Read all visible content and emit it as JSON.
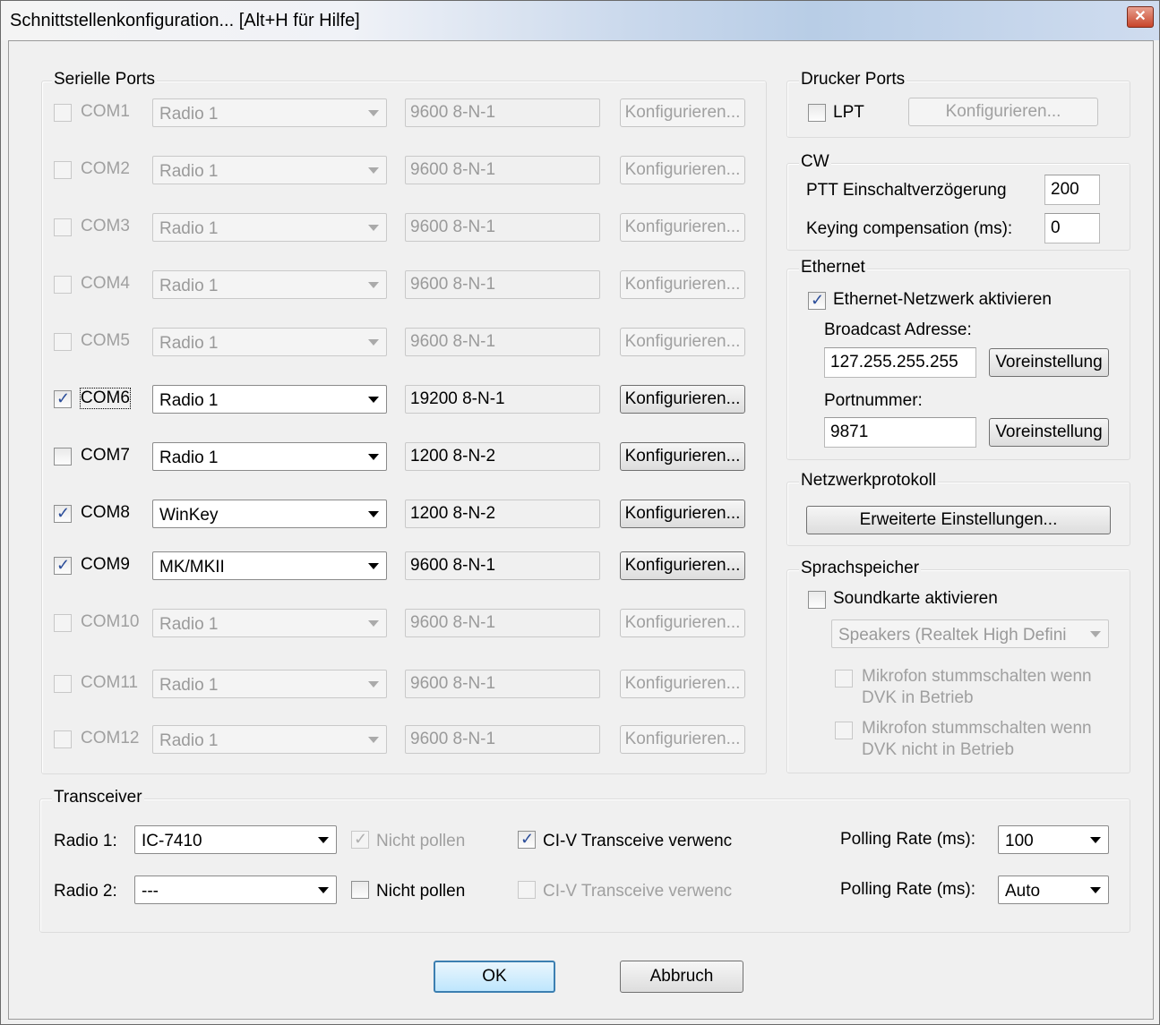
{
  "window": {
    "title": "Schnittstellenkonfiguration... [Alt+H für Hilfe]",
    "close_glyph": "✕"
  },
  "serial": {
    "group_label": "Serielle Ports",
    "config_label": "Konfigurieren...",
    "ports": [
      {
        "name": "COM1",
        "checked": false,
        "enabled": false,
        "radio": "Radio 1",
        "settings": "9600 8-N-1"
      },
      {
        "name": "COM2",
        "checked": false,
        "enabled": false,
        "radio": "Radio 1",
        "settings": "9600 8-N-1"
      },
      {
        "name": "COM3",
        "checked": false,
        "enabled": false,
        "radio": "Radio 1",
        "settings": "9600 8-N-1"
      },
      {
        "name": "COM4",
        "checked": false,
        "enabled": false,
        "radio": "Radio 1",
        "settings": "9600 8-N-1"
      },
      {
        "name": "COM5",
        "checked": false,
        "enabled": false,
        "radio": "Radio 1",
        "settings": "9600 8-N-1"
      },
      {
        "name": "COM6",
        "checked": true,
        "enabled": true,
        "radio": "Radio 1",
        "settings": "19200 8-N-1"
      },
      {
        "name": "COM7",
        "checked": false,
        "enabled": true,
        "radio": "Radio 1",
        "settings": "1200 8-N-2"
      },
      {
        "name": "COM8",
        "checked": true,
        "enabled": true,
        "radio": "WinKey",
        "settings": "1200 8-N-2"
      },
      {
        "name": "COM9",
        "checked": true,
        "enabled": true,
        "radio": "MK/MKII",
        "settings": "9600 8-N-1"
      },
      {
        "name": "COM10",
        "checked": false,
        "enabled": false,
        "radio": "Radio 1",
        "settings": "9600 8-N-1"
      },
      {
        "name": "COM11",
        "checked": false,
        "enabled": false,
        "radio": "Radio 1",
        "settings": "9600 8-N-1"
      },
      {
        "name": "COM12",
        "checked": false,
        "enabled": false,
        "radio": "Radio 1",
        "settings": "9600 8-N-1"
      }
    ]
  },
  "printer": {
    "group_label": "Drucker Ports",
    "lpt_label": "LPT",
    "lpt_checked": false,
    "config_label": "Konfigurieren..."
  },
  "cw": {
    "group_label": "CW",
    "ptt_label": "PTT Einschaltverzögerung",
    "ptt_value": "200",
    "keying_label": "Keying compensation (ms):",
    "keying_value": "0"
  },
  "ethernet": {
    "group_label": "Ethernet",
    "enable_label": "Ethernet-Netzwerk aktivieren",
    "enable_checked": true,
    "broadcast_label": "Broadcast Adresse:",
    "broadcast_value": "127.255.255.255",
    "default_label": "Voreinstellung",
    "port_label": "Portnummer:",
    "port_value": "9871"
  },
  "netproto": {
    "group_label": "Netzwerkprotokoll",
    "advanced_label": "Erweiterte Einstellungen..."
  },
  "voice": {
    "group_label": "Sprachspeicher",
    "soundcard_label": "Soundkarte aktivieren",
    "soundcard_checked": false,
    "device_value": "Speakers (Realtek High Defini",
    "mute1_line1": "Mikrofon stummschalten wenn",
    "mute1_line2": "DVK in Betrieb",
    "mute2_line1": "Mikrofon stummschalten wenn",
    "mute2_line2": "DVK nicht in Betrieb"
  },
  "transceiver": {
    "group_label": "Transceiver",
    "radio1_label": "Radio 1:",
    "radio1_value": "IC-7410",
    "radio1_nopoll_label": "Nicht pollen",
    "radio1_nopoll_checked": true,
    "radio1_civ_label": "CI-V Transceive verwenc",
    "radio1_civ_checked": true,
    "radio1_rate_label": "Polling Rate (ms):",
    "radio1_rate_value": "100",
    "radio2_label": "Radio 2:",
    "radio2_value": "---",
    "radio2_nopoll_label": "Nicht pollen",
    "radio2_nopoll_checked": false,
    "radio2_civ_label": "CI-V Transceive verwenc",
    "radio2_civ_checked": false,
    "radio2_rate_label": "Polling Rate (ms):",
    "radio2_rate_value": "Auto"
  },
  "footer": {
    "ok_label": "OK",
    "cancel_label": "Abbruch"
  },
  "glyphs": {
    "check": "✓"
  }
}
